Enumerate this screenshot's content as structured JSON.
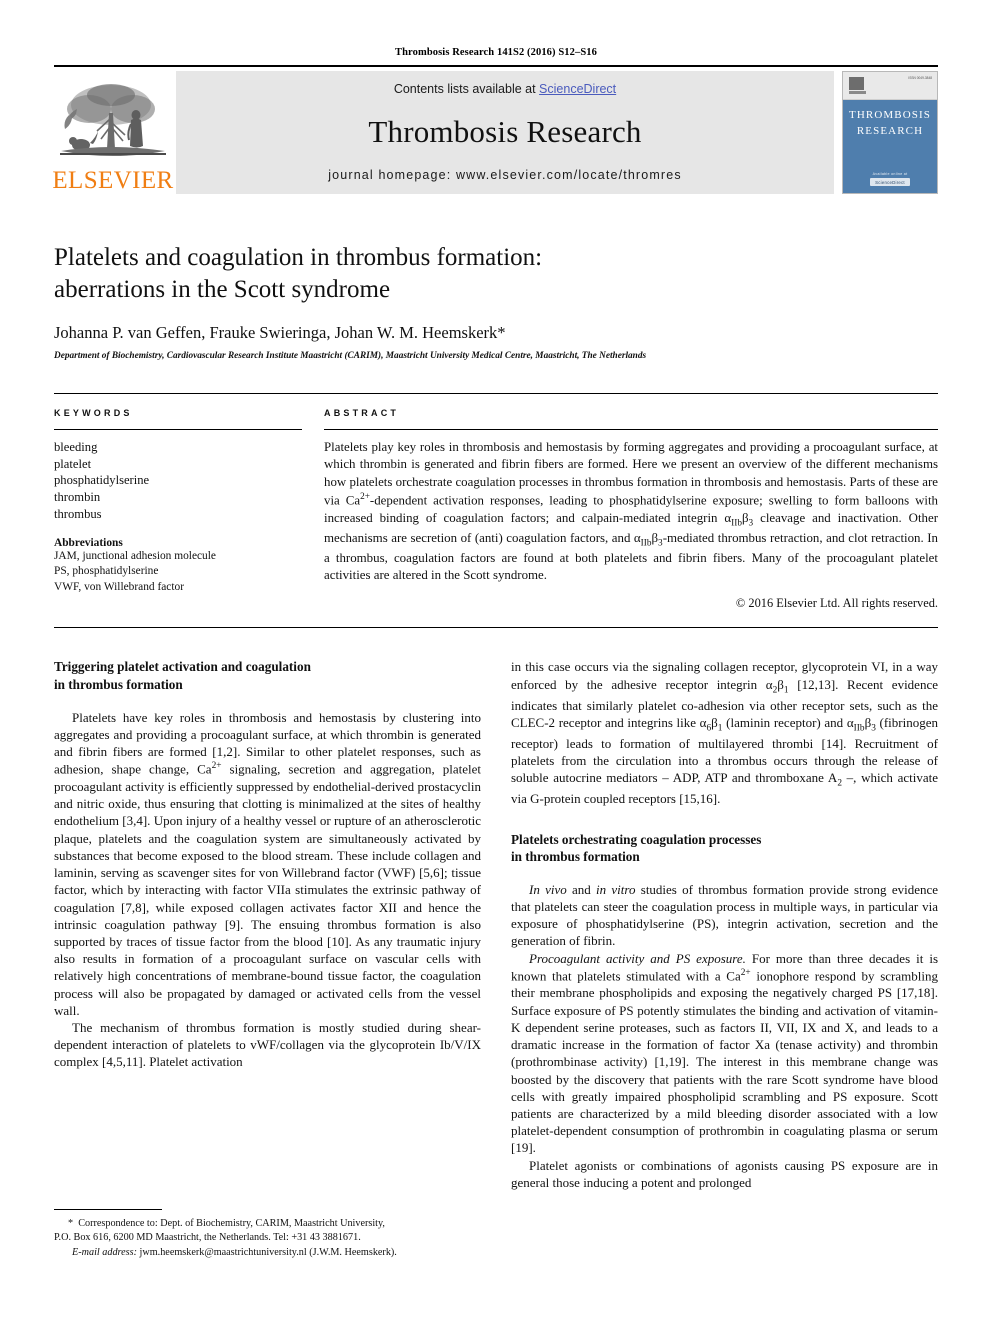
{
  "running_head": "Thrombosis Research 141S2 (2016) S12–S16",
  "masthead": {
    "publisher_wordmark": "ELSEVIER",
    "contents_prefix": "Contents lists available at ",
    "sciencedirect": "ScienceDirect",
    "journal_title": "Thrombosis Research",
    "homepage": "journal homepage: www.elsevier.com/locate/thromres",
    "cover": {
      "title_line1": "THROMBOSIS",
      "title_line2": "RESEARCH",
      "issn_text": "ISSN 0049-3848",
      "bottom_text": "Available online at",
      "sd_badge": "ScienceDirect"
    },
    "sciencedirect_color": "#4a5bbd",
    "elsevier_orange": "#F07E13",
    "banner_bg": "#e6e6e6",
    "cover_blue": "#4f7ead"
  },
  "article": {
    "title_line1": "Platelets and coagulation in thrombus formation:",
    "title_line2": "aberrations in the Scott syndrome",
    "authors": "Johanna P. van Geffen, Frauke Swieringa, Johan W. M. Heemskerk*",
    "affiliation": "Department of Biochemistry, Cardiovascular Research Institute Maastricht (CARIM), Maastricht University Medical Centre, Maastricht, The Netherlands"
  },
  "keywords_panel": {
    "heading": "KEYWORDS",
    "items": [
      "bleeding",
      "platelet",
      "phosphatidylserine",
      "thrombin",
      "thrombus"
    ],
    "abbreviations_heading": "Abbreviations",
    "abbreviations": [
      "JAM, junctional adhesion molecule",
      "PS, phosphatidylserine",
      "VWF, von Willebrand factor"
    ]
  },
  "abstract_panel": {
    "heading": "ABSTRACT",
    "text_part1": "Platelets play key roles in thrombosis and hemostasis by forming aggregates and providing a procoagulant surface, at which thrombin is generated and fibrin fibers are formed. Here we present an overview of the different mechanisms how platelets orchestrate coagulation processes in thrombus formation in thrombosis and hemostasis. Parts of these are via Ca",
    "sup1": "2+",
    "text_part2": "-dependent activation responses, leading to phosphatidylserine exposure; swelling to form balloons with increased binding of coagulation factors; and calpain-mediated integrin α",
    "sub1": "IIb",
    "text_part3": "β",
    "sub2": "3",
    "text_part4": " cleavage and inactivation. Other mechanisms are secretion of (anti) coagulation factors, and α",
    "sub3": "IIb",
    "text_part5": "β",
    "sub4": "3",
    "text_part6": "-mediated thrombus retraction, and clot retraction. In a thrombus, coagulation factors are found at both platelets and fibrin fibers. Many of the procoagulant platelet activities are altered in the Scott syndrome.",
    "copyright": "© 2016 Elsevier Ltd. All rights reserved."
  },
  "body": {
    "left_column": {
      "heading1_line1": "Triggering platelet activation and coagulation",
      "heading1_line2": "in thrombus formation",
      "para1_a": "Platelets have key roles in thrombosis and hemostasis by clustering into aggregates and providing a procoagulant surface, at which thrombin is generated and fibrin fibers are formed [1,2]. Similar to other platelet responses, such as adhesion, shape change, Ca",
      "para1_sup": "2+",
      "para1_b": " signaling, secretion and aggregation, platelet procoagulant activity is efficiently suppressed by endothelial-derived prostacyclin and nitric oxide, thus ensuring that clotting is minimalized at the sites of healthy endothelium [3,4]. Upon injury of a healthy vessel or rupture of an atherosclerotic plaque, platelets and the coagulation system are simultaneously activated by substances that become exposed to the blood stream. These include collagen and laminin, serving as scavenger sites for von Willebrand factor (VWF) [5,6]; tissue factor, which by interacting with factor VIIa stimulates the extrinsic pathway of coagulation [7,8], while exposed collagen activates factor XII and hence the intrinsic coagulation pathway [9]. The ensuing thrombus formation is also supported by traces of tissue factor from the blood [10]. As any traumatic injury also results in formation of a procoagulant surface on vascular cells with relatively high concentrations of membrane-bound tissue factor, the coagulation process will also be propagated by damaged or activated cells from the vessel wall.",
      "para2": "The mechanism of thrombus formation is mostly studied during shear-dependent interaction of platelets to vWF/collagen via the glycoprotein Ib/V/IX complex [4,5,11]. Platelet activation"
    },
    "right_column": {
      "para1_a": "in this case occurs via the signaling collagen receptor, glycoprotein VI, in a way enforced by the adhesive receptor integrin α",
      "para1_sub1": "2",
      "para1_b": "β",
      "para1_sub2": "1",
      "para1_c": " [12,13]. Recent evidence indicates that similarly platelet co-adhesion via other receptor sets, such as the CLEC-2 receptor and integrins like α",
      "para1_sub3": "6",
      "para1_d": "β",
      "para1_sub4": "1",
      "para1_e": " (laminin receptor) and α",
      "para1_sub5": "IIb",
      "para1_f": "β",
      "para1_sub6": "3",
      "para1_g": " (fibrinogen receptor) leads to formation of multilayered thrombi [14]. Recruitment of platelets from the circulation into a thrombus occurs through the release of soluble autocrine mediators – ADP, ATP and thromboxane A",
      "para1_sub7": "2",
      "para1_h": " –, which activate via G-protein coupled receptors [15,16].",
      "heading2_line1": "Platelets orchestrating coagulation processes",
      "heading2_line2": "in thrombus formation",
      "para2_ital1": "In vivo",
      "para2_a": " and ",
      "para2_ital2": "in vitro",
      "para2_b": " studies of thrombus formation provide strong evidence that platelets can steer the coagulation process in multiple ways, in particular via exposure of phosphatidylserine (PS), integrin activation, secretion and the generation of fibrin.",
      "para3_ital": "Procoagulant activity and PS exposure.",
      "para3_a": " For more than three decades it is known that platelets stimulated with a Ca",
      "para3_sup": "2+",
      "para3_b": " ionophore respond by scrambling their membrane phospholipids and exposing the negatively charged PS [17,18]. Surface exposure of PS potently stimulates the binding and activation of vitamin-K dependent serine proteases, such as factors II, VII, IX and X, and leads to a dramatic increase in the formation of factor Xa (tenase activity) and thrombin (prothrombinase activity) [1,19]. The interest in this membrane change was boosted by the discovery that patients with the rare Scott syndrome have blood cells with greatly impaired phospholipid scrambling and PS exposure. Scott patients are characterized by a mild bleeding disorder associated with a low platelet-dependent consumption of prothrombin in coagulating plasma or serum [19].",
      "para4": "Platelet agonists or combinations of agonists causing PS exposure are in general those inducing a potent and prolonged"
    }
  },
  "footnote": {
    "star": "*",
    "line1": "Correspondence to: Dept. of Biochemistry, CARIM, Maastricht University,",
    "line2": "P.O. Box 616, 6200 MD Maastricht, the Netherlands. Tel: +31 43 3881671.",
    "email_label": "E-mail address:",
    "email_value": " jwm.heemskerk@maastrichtuniversity.nl (J.W.M. Heemskerk)."
  }
}
